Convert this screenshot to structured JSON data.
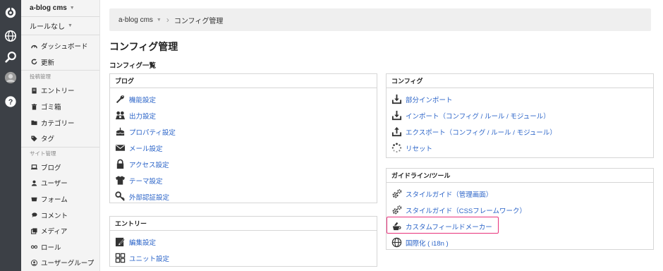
{
  "rail": {
    "icons": [
      "acms-logo-icon",
      "globe-icon",
      "search-icon",
      "user-avatar-icon",
      "help-icon"
    ]
  },
  "sidebar": {
    "site_select": "a-blog cms",
    "rule_select": "ルールなし",
    "top_items": [
      {
        "label": "ダッシュボード",
        "icon": "dashboard-icon"
      },
      {
        "label": "更新",
        "icon": "refresh-icon"
      }
    ],
    "post_heading": "投稿管理",
    "post_items": [
      {
        "label": "エントリー",
        "icon": "entry-icon"
      },
      {
        "label": "ゴミ箱",
        "icon": "trash-icon"
      },
      {
        "label": "カテゴリー",
        "icon": "folder-icon"
      },
      {
        "label": "タグ",
        "icon": "tag-icon"
      }
    ],
    "site_heading": "サイト管理",
    "site_items": [
      {
        "label": "ブログ",
        "icon": "laptop-icon"
      },
      {
        "label": "ユーザー",
        "icon": "user-icon"
      },
      {
        "label": "フォーム",
        "icon": "form-icon"
      },
      {
        "label": "コメント",
        "icon": "comment-icon"
      },
      {
        "label": "メディア",
        "icon": "media-icon"
      },
      {
        "label": "ロール",
        "icon": "role-icon"
      },
      {
        "label": "ユーザーグループ",
        "icon": "group-icon"
      }
    ]
  },
  "breadcrumb": {
    "root": "a-blog cms",
    "current": "コンフィグ管理"
  },
  "page": {
    "title": "コンフィグ管理",
    "section_title": "コンフィグ一覧"
  },
  "panels": {
    "blog": {
      "title": "ブログ",
      "items": [
        {
          "label": "機能設定",
          "icon": "wrench-icon"
        },
        {
          "label": "出力設定",
          "icon": "output-icon"
        },
        {
          "label": "プロパティ設定",
          "icon": "cake-icon"
        },
        {
          "label": "メール設定",
          "icon": "mail-icon"
        },
        {
          "label": "アクセス設定",
          "icon": "lock-icon"
        },
        {
          "label": "テーマ設定",
          "icon": "shirt-icon"
        },
        {
          "label": "外部認証設定",
          "icon": "key-icon"
        }
      ]
    },
    "entry": {
      "title": "エントリー",
      "items": [
        {
          "label": "編集設定",
          "icon": "edit-icon"
        },
        {
          "label": "ユニット設定",
          "icon": "unit-grid-icon"
        }
      ]
    },
    "config": {
      "title": "コンフィグ",
      "items": [
        {
          "label": "部分インポート",
          "icon": "import-icon"
        },
        {
          "label": "インポート（コンフィグ / ルール / モジュール）",
          "icon": "import-icon"
        },
        {
          "label": "エクスポート（コンフィグ / ルール / モジュール）",
          "icon": "export-icon"
        },
        {
          "label": "リセット",
          "icon": "spinner-icon"
        }
      ]
    },
    "guide": {
      "title": "ガイドライン/ツール",
      "items": [
        {
          "label": "スタイルガイド（管理画面）",
          "icon": "gears-icon"
        },
        {
          "label": "スタイルガイド（CSSフレームワーク）",
          "icon": "gears-icon"
        },
        {
          "label": "カスタムフィールドメーカー",
          "icon": "field-maker-icon"
        },
        {
          "label": "国際化 ( i18n )",
          "icon": "globe-icon"
        }
      ]
    }
  },
  "colors": {
    "rail": "#3c4046",
    "link": "#2b64c8",
    "highlight": "#e8317a"
  }
}
